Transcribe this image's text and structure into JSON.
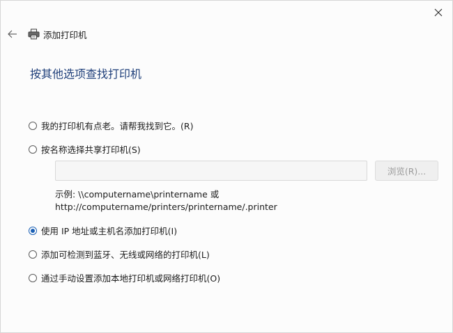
{
  "window": {
    "title": "添加打印机",
    "close_glyph": "✕",
    "back_glyph": "←"
  },
  "page": {
    "title": "按其他选项查找打印机"
  },
  "options": [
    {
      "label": "我的打印机有点老。请帮我找到它。(R)",
      "checked": false
    },
    {
      "label": "按名称选择共享打印机(S)",
      "checked": false
    },
    {
      "label": "使用 IP 地址或主机名添加打印机(I)",
      "checked": true
    },
    {
      "label": "添加可检测到蓝牙、无线或网络的打印机(L)",
      "checked": false
    },
    {
      "label": "通过手动设置添加本地打印机或网络打印机(O)",
      "checked": false
    }
  ],
  "shared_printer": {
    "input_value": "",
    "browse_label": "浏览(R)...",
    "example_line1": "示例: \\\\computername\\printername 或",
    "example_line2": "http://computername/printers/printername/.printer"
  },
  "colors": {
    "title_blue": "#1f3f7a",
    "accent": "#1a5fb4"
  },
  "icons": {
    "close": "close-icon",
    "back": "back-arrow-icon",
    "printer": "printer-icon"
  }
}
